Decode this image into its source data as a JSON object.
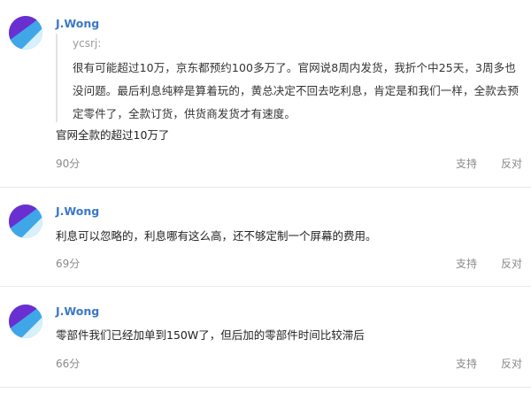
{
  "comments": [
    {
      "username": "J.Wong",
      "quote": {
        "author": "ycsrj:",
        "text": "很有可能超过10万，京东都预约100多万了。官网说8周内发货，我折个中25天，3周多也没问题。最后利息纯粹是算着玩的，黄总决定不回去吃利息，肯定是和我们一样，全款去预定零件了，全款订货，供货商发货才有速度。"
      },
      "text": "官网全款的超过10万了",
      "score": "90分",
      "support_label": "支持",
      "oppose_label": "反对"
    },
    {
      "username": "J.Wong",
      "text": "利息可以忽略的，利息哪有这么高，还不够定制一个屏幕的费用。",
      "score": "69分",
      "support_label": "支持",
      "oppose_label": "反对"
    },
    {
      "username": "J.Wong",
      "text": "零部件我们已经加单到150W了，但后加的零部件时间比较滞后",
      "score": "66分",
      "support_label": "支持",
      "oppose_label": "反对"
    }
  ],
  "colors": {
    "username": "#3a78c6",
    "avatar_blue": "#3fa6e8",
    "avatar_purple": "#6a2fd0",
    "avatar_light": "#d8f0fc"
  }
}
